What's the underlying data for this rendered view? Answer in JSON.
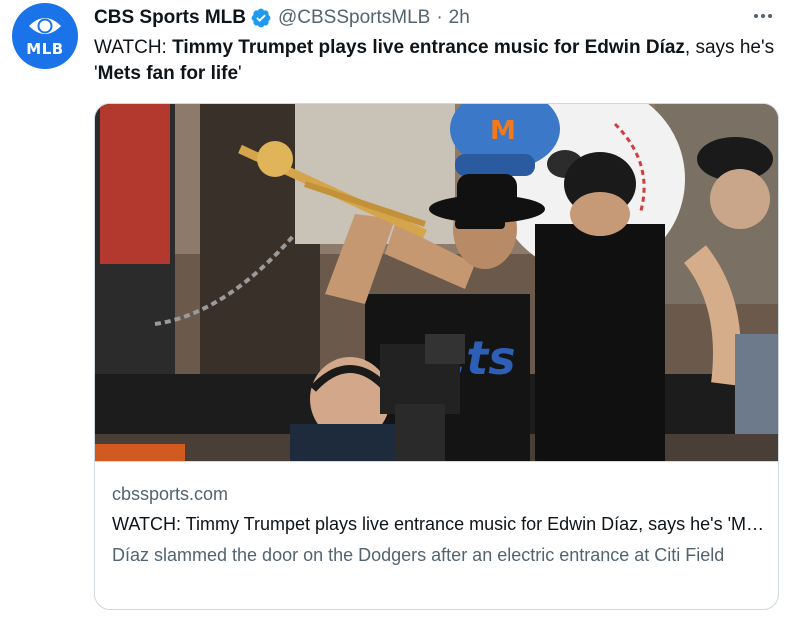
{
  "tweet": {
    "author_name": "CBS Sports MLB",
    "handle": "@CBSSportsMLB",
    "separator": "·",
    "time": "2h",
    "avatar_label": "MLB",
    "text_prefix": "WATCH: ",
    "text_bold": "Timmy Trumpet plays live entrance music for Edwin Díaz",
    "text_plain": ", says he's '",
    "text_bold2": "Mets fan for life",
    "text_suffix": "'"
  },
  "card": {
    "domain": "cbssports.com",
    "title": "WATCH: Timmy Trumpet plays live entrance music for Edwin Díaz, says he's 'Mets fan for life'",
    "description": "Díaz slammed the door on the Dodgers after an electric entrance at Citi Field"
  },
  "icons": {
    "avatar": "cbs-eye-logo",
    "verified": "verified-badge-icon",
    "more": "more-options-icon"
  },
  "colors": {
    "avatar_bg": "#1a73e8",
    "verified": "#1d9bf0",
    "secondary_text": "#536471",
    "primary_text": "#0f1419",
    "border": "#cfd9de"
  }
}
